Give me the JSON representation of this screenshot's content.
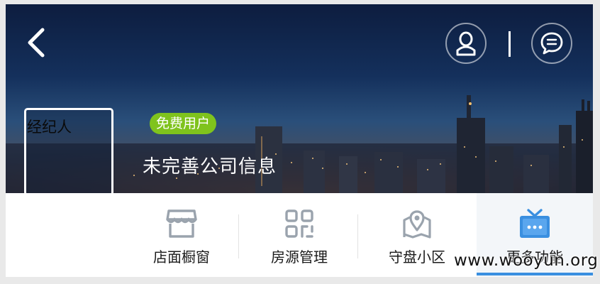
{
  "header": {
    "back_icon": "chevron-left-icon",
    "profile_icon": "user-icon",
    "message_icon": "chat-bubble-icon"
  },
  "profile": {
    "avatar_alt": "经纪人",
    "badge": "免费用户",
    "company": "未完善公司信息"
  },
  "toolbar": {
    "items": [
      {
        "label": "店面橱窗",
        "icon": "storefront-icon"
      },
      {
        "label": "房源管理",
        "icon": "grid-icon"
      },
      {
        "label": "守盘小区",
        "icon": "map-pin-icon"
      },
      {
        "label": "更多功能",
        "icon": "tv-more-icon"
      }
    ],
    "active_index": 3
  },
  "watermark": "www.wooyun.org",
  "colors": {
    "badge": "#7fc31d",
    "icon_gray": "#9aa3ad",
    "accent_blue": "#3a8fe0",
    "banner_dark": "#0d1d3f"
  }
}
